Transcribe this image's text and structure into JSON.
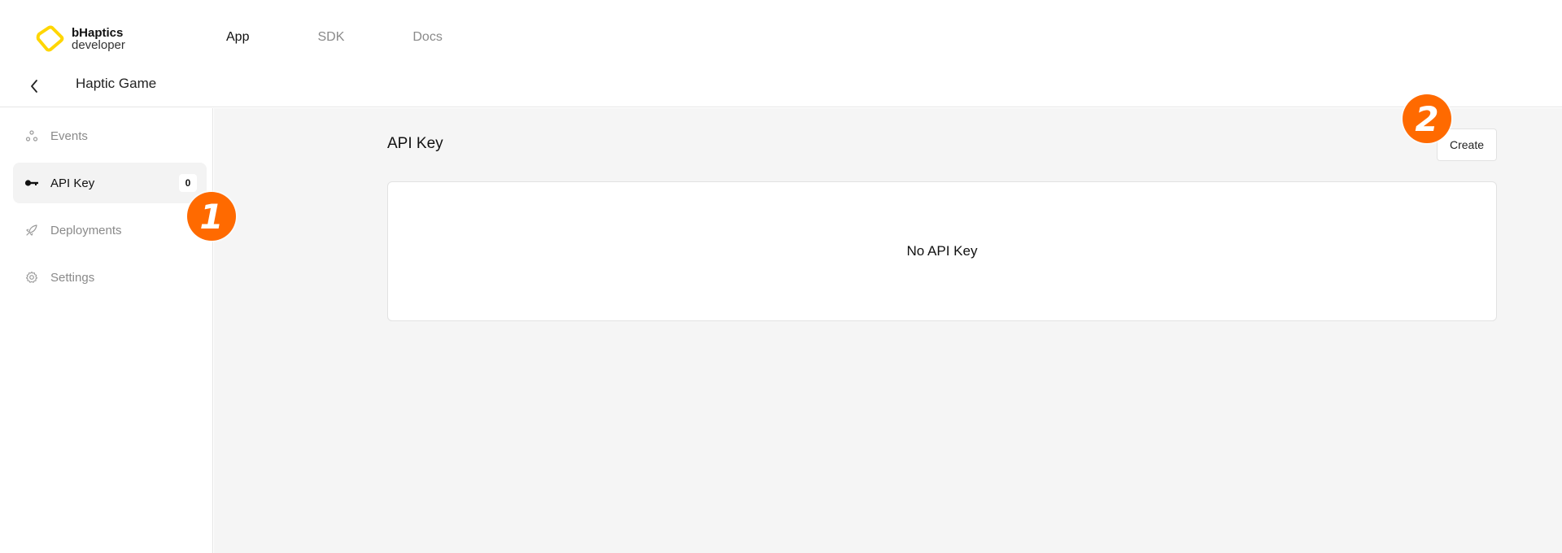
{
  "brand": {
    "name": "bHaptics",
    "sub": "developer",
    "accent_color": "#ffd600",
    "logo_icon": "bhaptics-logo-icon"
  },
  "nav": {
    "items": [
      {
        "label": "App",
        "active": true
      },
      {
        "label": "SDK",
        "active": false
      },
      {
        "label": "Docs",
        "active": false
      }
    ]
  },
  "breadcrumb": {
    "back_icon": "chevron-left-icon",
    "title": "Haptic Game"
  },
  "sidebar": {
    "items": [
      {
        "label": "Events",
        "icon": "events-icon",
        "active": false
      },
      {
        "label": "API Key",
        "icon": "key-icon",
        "active": true,
        "badge": "0"
      },
      {
        "label": "Deployments",
        "icon": "rocket-icon",
        "active": false
      },
      {
        "label": "Settings",
        "icon": "gear-icon",
        "active": false
      }
    ]
  },
  "main": {
    "section_title": "API Key",
    "create_label": "Create",
    "empty_message": "No API Key",
    "background_color": "#f5f5f5"
  },
  "markers": [
    {
      "label": "1",
      "color": "#ff6a00"
    },
    {
      "label": "2",
      "color": "#ff6a00"
    }
  ]
}
